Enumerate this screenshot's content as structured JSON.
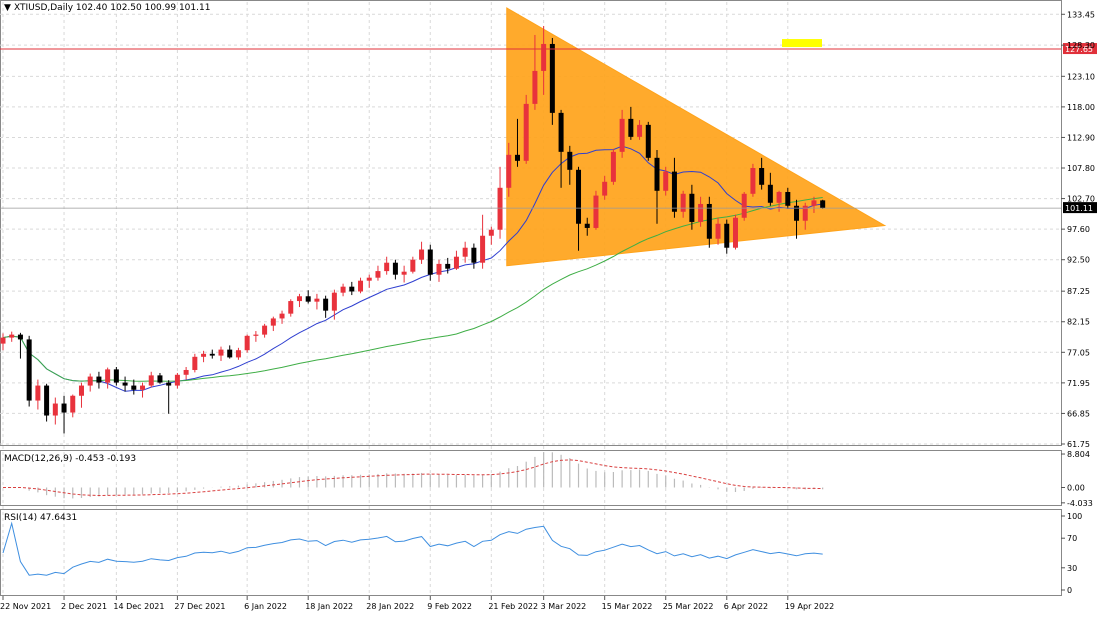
{
  "colors": {
    "bull": "#e8323c",
    "bear": "#000000",
    "ma_fast": "#2f3fd0",
    "ma_slow": "#3fae46",
    "triangle": "#ffa31a",
    "hline": "#e0303a",
    "hline_label_bg": "#e0303a",
    "last_label_bg": "#000000",
    "macd_signal": "#d94040",
    "macd_hist": "#bbbbbb",
    "rsi": "#3f8fe0",
    "grid": "#d9d9d9",
    "axis": "#555555",
    "tag_bg": "#ffff00"
  },
  "chart_data": [
    {
      "type": "candlestick",
      "title": "XTIUSD,Daily  102.40 102.50 100.99 101.11",
      "ylim": [
        61.75,
        135.5
      ],
      "y_ticks": [
        "133.45",
        "128.30",
        "123.10",
        "118.00",
        "112.90",
        "107.80",
        "102.70",
        "97.60",
        "92.50",
        "87.25",
        "82.15",
        "77.05",
        "71.95",
        "66.85",
        "61.75"
      ],
      "x_labels": [
        "22 Nov 2021",
        "2 Dec 2021",
        "14 Dec 2021",
        "27 Dec 2021",
        "6 Jan 2022",
        "18 Jan 2022",
        "28 Jan 2022",
        "9 Feb 2022",
        "21 Feb 2022",
        "3 Mar 2022",
        "15 Mar 2022",
        "25 Mar 2022",
        "6 Apr 2022",
        "19 Apr 2022"
      ],
      "horizontal_line": {
        "value": 127.65,
        "label": "127.65"
      },
      "last_price": {
        "value": 101.11,
        "label": "101.11"
      },
      "tag_label": "",
      "triangle": {
        "apex_left_top": 134.5,
        "apex_left_bottom": 91.5,
        "apex_right": 98.2
      },
      "ohlc": [
        [
          78.5,
          80.2,
          77.4,
          79.5
        ],
        [
          79.5,
          80.5,
          78.8,
          80.0
        ],
        [
          80.0,
          80.3,
          76.0,
          79.2
        ],
        [
          79.2,
          79.8,
          68.0,
          69.0
        ],
        [
          69.0,
          72.5,
          67.5,
          71.5
        ],
        [
          71.5,
          71.8,
          65.5,
          66.5
        ],
        [
          66.5,
          69.5,
          65.0,
          68.5
        ],
        [
          68.5,
          69.8,
          63.5,
          67.0
        ],
        [
          67.0,
          70.0,
          66.2,
          69.8
        ],
        [
          69.8,
          72.0,
          67.8,
          71.5
        ],
        [
          71.5,
          73.5,
          70.5,
          73.0
        ],
        [
          73.0,
          73.8,
          71.0,
          72.0
        ],
        [
          72.0,
          74.5,
          71.0,
          74.2
        ],
        [
          74.2,
          74.6,
          71.5,
          72.0
        ],
        [
          72.0,
          73.0,
          70.5,
          71.5
        ],
        [
          71.5,
          72.5,
          70.0,
          70.8
        ],
        [
          70.8,
          72.0,
          69.5,
          71.5
        ],
        [
          71.5,
          73.8,
          71.2,
          73.2
        ],
        [
          73.2,
          73.6,
          71.8,
          72.0
        ],
        [
          72.0,
          72.4,
          66.8,
          71.5
        ],
        [
          71.5,
          73.6,
          71.0,
          73.3
        ],
        [
          73.3,
          74.6,
          72.5,
          74.1
        ],
        [
          74.1,
          76.8,
          73.7,
          76.3
        ],
        [
          76.3,
          77.3,
          75.4,
          76.8
        ],
        [
          76.8,
          77.5,
          76.0,
          76.5
        ],
        [
          76.5,
          78.0,
          75.6,
          77.5
        ],
        [
          77.5,
          78.2,
          76.0,
          76.2
        ],
        [
          76.2,
          77.8,
          75.8,
          77.4
        ],
        [
          77.4,
          80.0,
          77.0,
          79.8
        ],
        [
          79.8,
          80.6,
          78.8,
          80.0
        ],
        [
          80.0,
          81.8,
          79.5,
          81.5
        ],
        [
          81.5,
          83.0,
          80.6,
          82.7
        ],
        [
          82.7,
          84.0,
          81.8,
          83.5
        ],
        [
          83.5,
          85.9,
          83.0,
          85.6
        ],
        [
          85.6,
          86.8,
          84.6,
          86.4
        ],
        [
          86.4,
          87.4,
          85.2,
          85.5
        ],
        [
          85.5,
          86.8,
          84.2,
          86.0
        ],
        [
          86.0,
          86.5,
          82.8,
          84.0
        ],
        [
          84.0,
          87.5,
          82.5,
          87.0
        ],
        [
          87.0,
          88.5,
          86.4,
          88.0
        ],
        [
          88.0,
          88.8,
          86.6,
          87.2
        ],
        [
          87.2,
          89.5,
          86.9,
          89.0
        ],
        [
          89.0,
          90.0,
          87.8,
          89.5
        ],
        [
          89.5,
          91.5,
          89.0,
          90.6
        ],
        [
          90.6,
          93.0,
          90.0,
          92.0
        ],
        [
          92.0,
          92.5,
          89.2,
          90.0
        ],
        [
          90.0,
          91.5,
          88.7,
          90.5
        ],
        [
          90.5,
          93.0,
          90.2,
          92.5
        ],
        [
          92.5,
          95.5,
          91.8,
          94.2
        ],
        [
          94.2,
          95.0,
          89.0,
          90.0
        ],
        [
          90.0,
          92.5,
          88.8,
          91.8
        ],
        [
          91.8,
          92.8,
          90.2,
          91.0
        ],
        [
          91.0,
          94.0,
          90.8,
          93.0
        ],
        [
          93.0,
          95.5,
          92.0,
          94.5
        ],
        [
          94.5,
          95.2,
          91.0,
          92.0
        ],
        [
          92.0,
          100.0,
          91.0,
          96.5
        ],
        [
          96.5,
          98.0,
          95.0,
          97.5
        ],
        [
          97.5,
          108.0,
          96.0,
          104.5
        ],
        [
          104.5,
          112.0,
          103.0,
          110.0
        ],
        [
          110.0,
          116.0,
          108.0,
          109.0
        ],
        [
          109.0,
          120.0,
          108.5,
          118.5
        ],
        [
          118.5,
          130.0,
          117.5,
          124.0
        ],
        [
          124.0,
          131.5,
          120.0,
          128.5
        ],
        [
          128.5,
          129.5,
          115.0,
          117.0
        ],
        [
          117.0,
          117.5,
          104.5,
          110.5
        ],
        [
          110.5,
          111.5,
          105.0,
          107.5
        ],
        [
          107.5,
          108.0,
          94.0,
          98.5
        ],
        [
          98.5,
          99.5,
          96.5,
          97.8
        ],
        [
          97.8,
          104.0,
          97.5,
          103.2
        ],
        [
          103.2,
          106.5,
          102.5,
          105.5
        ],
        [
          105.5,
          111.0,
          105.0,
          110.5
        ],
        [
          110.5,
          117.5,
          109.5,
          116.0
        ],
        [
          116.0,
          118.0,
          112.5,
          113.0
        ],
        [
          113.0,
          115.8,
          112.5,
          115.0
        ],
        [
          115.0,
          115.5,
          109.0,
          109.5
        ],
        [
          109.5,
          110.8,
          98.5,
          104.0
        ],
        [
          104.0,
          108.0,
          103.2,
          107.2
        ],
        [
          107.2,
          109.5,
          99.5,
          100.5
        ],
        [
          100.5,
          104.0,
          99.5,
          103.5
        ],
        [
          103.5,
          105.0,
          97.5,
          98.8
        ],
        [
          98.8,
          103.0,
          98.0,
          101.8
        ],
        [
          101.8,
          103.0,
          94.5,
          96.0
        ],
        [
          96.0,
          99.5,
          95.0,
          98.5
        ],
        [
          98.5,
          99.2,
          93.5,
          94.5
        ],
        [
          94.5,
          100.0,
          94.2,
          99.5
        ],
        [
          99.5,
          103.8,
          99.0,
          103.5
        ],
        [
          103.5,
          108.5,
          103.0,
          107.8
        ],
        [
          107.8,
          109.5,
          104.2,
          105.0
        ],
        [
          105.0,
          107.0,
          101.5,
          102.0
        ],
        [
          102.0,
          104.0,
          100.5,
          103.8
        ],
        [
          103.8,
          104.5,
          101.0,
          101.5
        ],
        [
          101.5,
          102.5,
          96.0,
          99.0
        ],
        [
          99.0,
          102.0,
          97.5,
          101.5
        ],
        [
          101.5,
          103.0,
          100.3,
          102.4
        ],
        [
          102.4,
          102.5,
          100.99,
          101.11
        ]
      ]
    },
    {
      "type": "line",
      "title": "MACD(12,26,9) -0.453 -0.193",
      "ylim": [
        -4.6,
        9.6
      ],
      "y_ticks": [
        "8.804",
        "0.00",
        "-4.033"
      ]
    },
    {
      "type": "line",
      "title": "RSI(14) 47.6431",
      "ylim": [
        0,
        100
      ],
      "y_ticks": [
        "100",
        "70",
        "30",
        "0"
      ]
    }
  ]
}
